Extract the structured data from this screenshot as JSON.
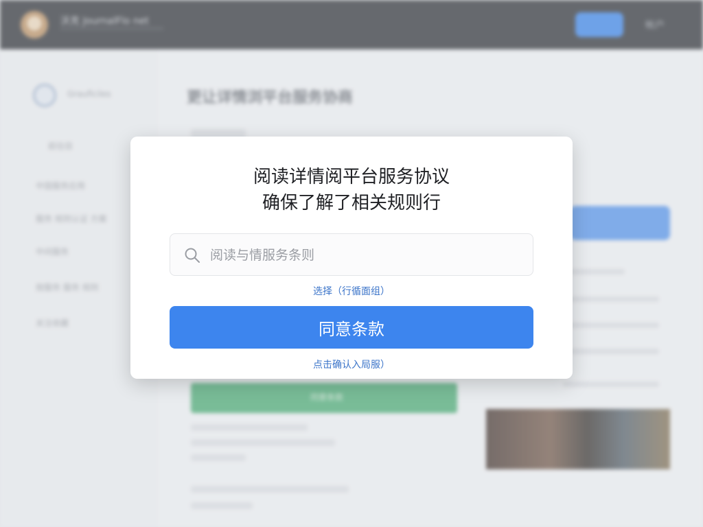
{
  "background": {
    "site_name": "沃克 JournalFlo net",
    "header_icon_label": "帐户",
    "sidebar": {
      "avatar_name": "Grauficiles",
      "items": [
        "前往目",
        "中国服务应用",
        "服务 规则认证 方案",
        "中间服务",
        "按服务 服务 规则",
        "关注收藏"
      ]
    },
    "main_title": "更让详情浏平台服务协商",
    "green_bar_label": "同意条款"
  },
  "modal": {
    "title_line1": "阅读详情阅平台服务协议",
    "title_line2": "确保了解了相关规则行",
    "search_placeholder": "阅读与情服务条则",
    "search_icon": "search-icon",
    "select_link": "选择（行循面组）",
    "agree_button": "同意条款",
    "confirm_link": "点击确认入局服）",
    "accent_color": "#3d85ee"
  }
}
